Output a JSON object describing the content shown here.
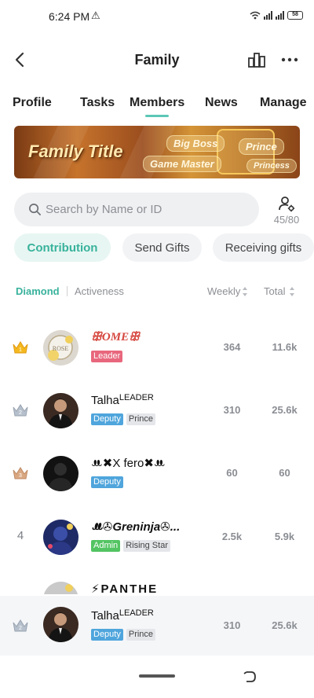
{
  "status": {
    "time": "6:24 PM",
    "battery": "58"
  },
  "header": {
    "title": "Family"
  },
  "tabs": [
    "Profile",
    "Tasks",
    "Members",
    "News",
    "Manage"
  ],
  "banner": {
    "title": "Family Title",
    "tags": [
      "Big Boss",
      "Prince",
      "Game Master",
      "Princess"
    ]
  },
  "search": {
    "placeholder": "Search by Name or ID",
    "member_count": "45/80"
  },
  "filters": [
    "Contribution",
    "Send Gifts",
    "Receiving gifts"
  ],
  "sort": {
    "primary": "Diamond",
    "secondary": "Activeness",
    "weekly": "Weekly",
    "total": "Total"
  },
  "members": [
    {
      "rank": "1",
      "name": "ꕥOMEꕥ",
      "badges": [
        "Leader"
      ],
      "weekly": "364",
      "total": "11.6k"
    },
    {
      "rank": "2",
      "name": "Talha",
      "name_sup": "LEADER",
      "badges": [
        "Deputy",
        "Prince"
      ],
      "weekly": "310",
      "total": "25.6k"
    },
    {
      "rank": "3",
      "name": "ꔚ✖X fero✖ꔚ",
      "badges": [
        "Deputy"
      ],
      "weekly": "60",
      "total": "60"
    },
    {
      "rank": "4",
      "name": "ꔚ✇Greninja✇...",
      "badges": [
        "Admin",
        "Rising Star"
      ],
      "weekly": "2.5k",
      "total": "5.9k"
    }
  ],
  "partial_member": {
    "name": "⚡PANTHE"
  },
  "my_row": {
    "rank": "2",
    "name": "Talha",
    "name_sup": "LEADER",
    "badges": [
      "Deputy",
      "Prince"
    ],
    "weekly": "310",
    "total": "25.6k"
  },
  "colors": {
    "accent": "#38b29c",
    "leader": "#e8677d",
    "deputy": "#4fa5dc",
    "admin": "#53c462"
  }
}
